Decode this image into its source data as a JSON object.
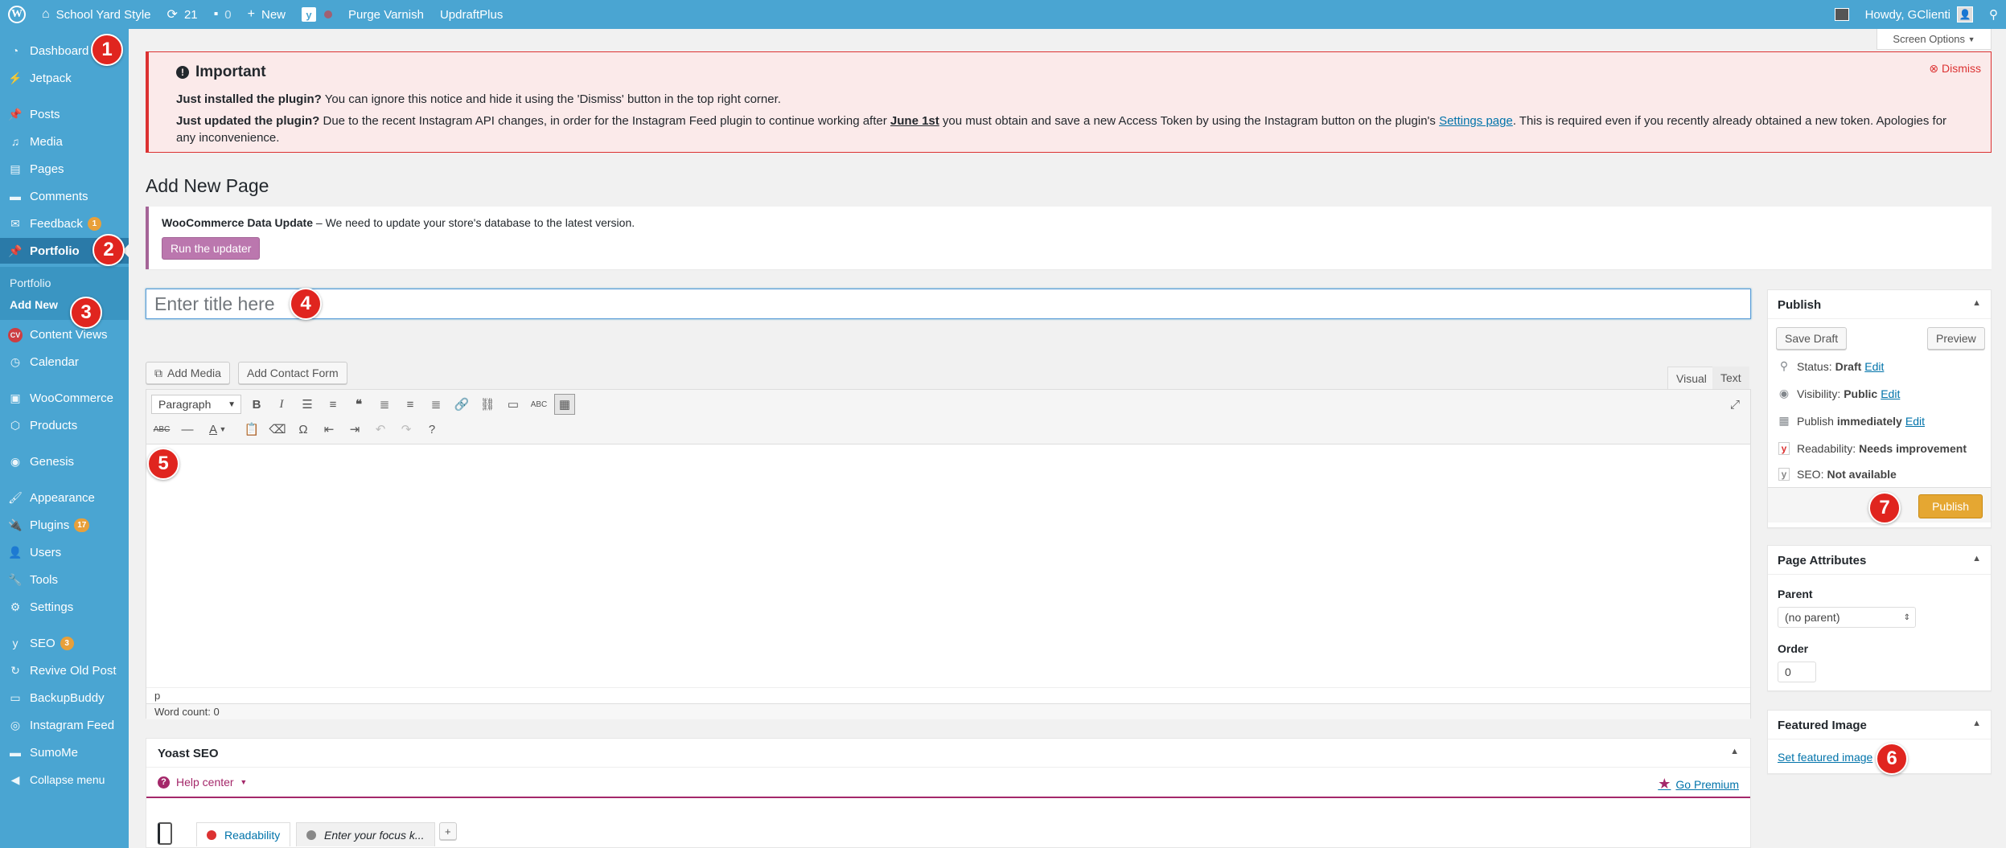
{
  "admin_bar": {
    "site_name": "School Yard Style",
    "updates_count": "21",
    "comments_count": "0",
    "new_label": "New",
    "purge_label": "Purge Varnish",
    "updraft_label": "UpdraftPlus",
    "howdy": "Howdy, GClienti"
  },
  "sidebar": {
    "items": [
      {
        "label": "Dashboard",
        "icon": "dashboard-icon"
      },
      {
        "label": "Jetpack",
        "icon": "jetpack-icon"
      },
      {
        "label": "Posts",
        "icon": "pin-icon"
      },
      {
        "label": "Media",
        "icon": "media-icon"
      },
      {
        "label": "Pages",
        "icon": "pages-icon"
      },
      {
        "label": "Comments",
        "icon": "comments-icon"
      },
      {
        "label": "Feedback",
        "icon": "feedback-icon",
        "badge": "1"
      },
      {
        "label": "Portfolio",
        "icon": "pin-icon"
      },
      {
        "label": "Content Views",
        "icon": "cv-icon"
      },
      {
        "label": "Calendar",
        "icon": "calendar-icon"
      },
      {
        "label": "WooCommerce",
        "icon": "woocommerce-icon"
      },
      {
        "label": "Products",
        "icon": "products-icon"
      },
      {
        "label": "Genesis",
        "icon": "genesis-icon"
      },
      {
        "label": "Appearance",
        "icon": "appearance-icon"
      },
      {
        "label": "Plugins",
        "icon": "plugins-icon",
        "badge": "17"
      },
      {
        "label": "Users",
        "icon": "users-icon"
      },
      {
        "label": "Tools",
        "icon": "tools-icon"
      },
      {
        "label": "Settings",
        "icon": "settings-icon"
      },
      {
        "label": "SEO",
        "icon": "yoast-icon",
        "badge": "3"
      },
      {
        "label": "Revive Old Post",
        "icon": "revive-icon"
      },
      {
        "label": "BackupBuddy",
        "icon": "backup-icon"
      },
      {
        "label": "Instagram Feed",
        "icon": "instagram-icon"
      },
      {
        "label": "SumoMe",
        "icon": "sumome-icon"
      },
      {
        "label": "Collapse menu",
        "icon": "collapse-icon"
      }
    ],
    "submenu": [
      "Portfolio",
      "Add New"
    ]
  },
  "markers": [
    "1",
    "2",
    "3",
    "4",
    "5",
    "6",
    "7"
  ],
  "screen_options": "Screen Options",
  "notice": {
    "title": "Important",
    "dismiss": "Dismiss",
    "line1_bold": "Just installed the plugin?",
    "line1_rest": " You can ignore this notice and hide it using the 'Dismiss' button in the top right corner.",
    "line2_bold": "Just updated the plugin?",
    "line2_rest_a": " Due to the recent Instagram API changes, in order for the Instagram Feed plugin to continue working after ",
    "line2_date": "June 1st",
    "line2_rest_b": " you must obtain and save a new Access Token by using the Instagram button on the plugin's ",
    "line2_link": "Settings page",
    "line2_rest_c": ". This is required even if you recently already obtained a new token. Apologies for any inconvenience."
  },
  "page_title": "Add New Page",
  "wc_notice": {
    "bold": "WooCommerce Data Update",
    "text": " – We need to update your store's database to the latest version.",
    "button": "Run the updater"
  },
  "title_input": {
    "placeholder": "Enter title here",
    "value": ""
  },
  "editor": {
    "add_media": "Add Media",
    "add_contact_form": "Add Contact Form",
    "tab_visual": "Visual",
    "tab_text": "Text",
    "format_select": "Paragraph",
    "path": "p",
    "word_count": "Word count: 0"
  },
  "yoast": {
    "title": "Yoast SEO",
    "help_center": "Help center",
    "go_premium": "Go Premium",
    "tab_readability": "Readability",
    "tab_focus": "Enter your focus k...",
    "add_tab": "+"
  },
  "publish": {
    "title": "Publish",
    "save_draft": "Save Draft",
    "preview": "Preview",
    "status_label": "Status:",
    "status_value": "Draft",
    "visibility_label": "Visibility:",
    "visibility_value": "Public",
    "publish_label": "Publish",
    "publish_value": "immediately",
    "edit": "Edit",
    "readability_label": "Readability:",
    "readability_value": "Needs improvement",
    "seo_label": "SEO:",
    "seo_value": "Not available",
    "publish_button": "Publish"
  },
  "page_attributes": {
    "title": "Page Attributes",
    "parent_label": "Parent",
    "parent_value": "(no parent)",
    "order_label": "Order",
    "order_value": "0"
  },
  "featured_image": {
    "title": "Featured Image",
    "link": "Set featured image"
  },
  "colors": {
    "admin_blue": "#4aa5d2",
    "marker_red": "#e0251f",
    "publish_orange": "#e5a732",
    "woo_purple": "#bb77ae"
  }
}
